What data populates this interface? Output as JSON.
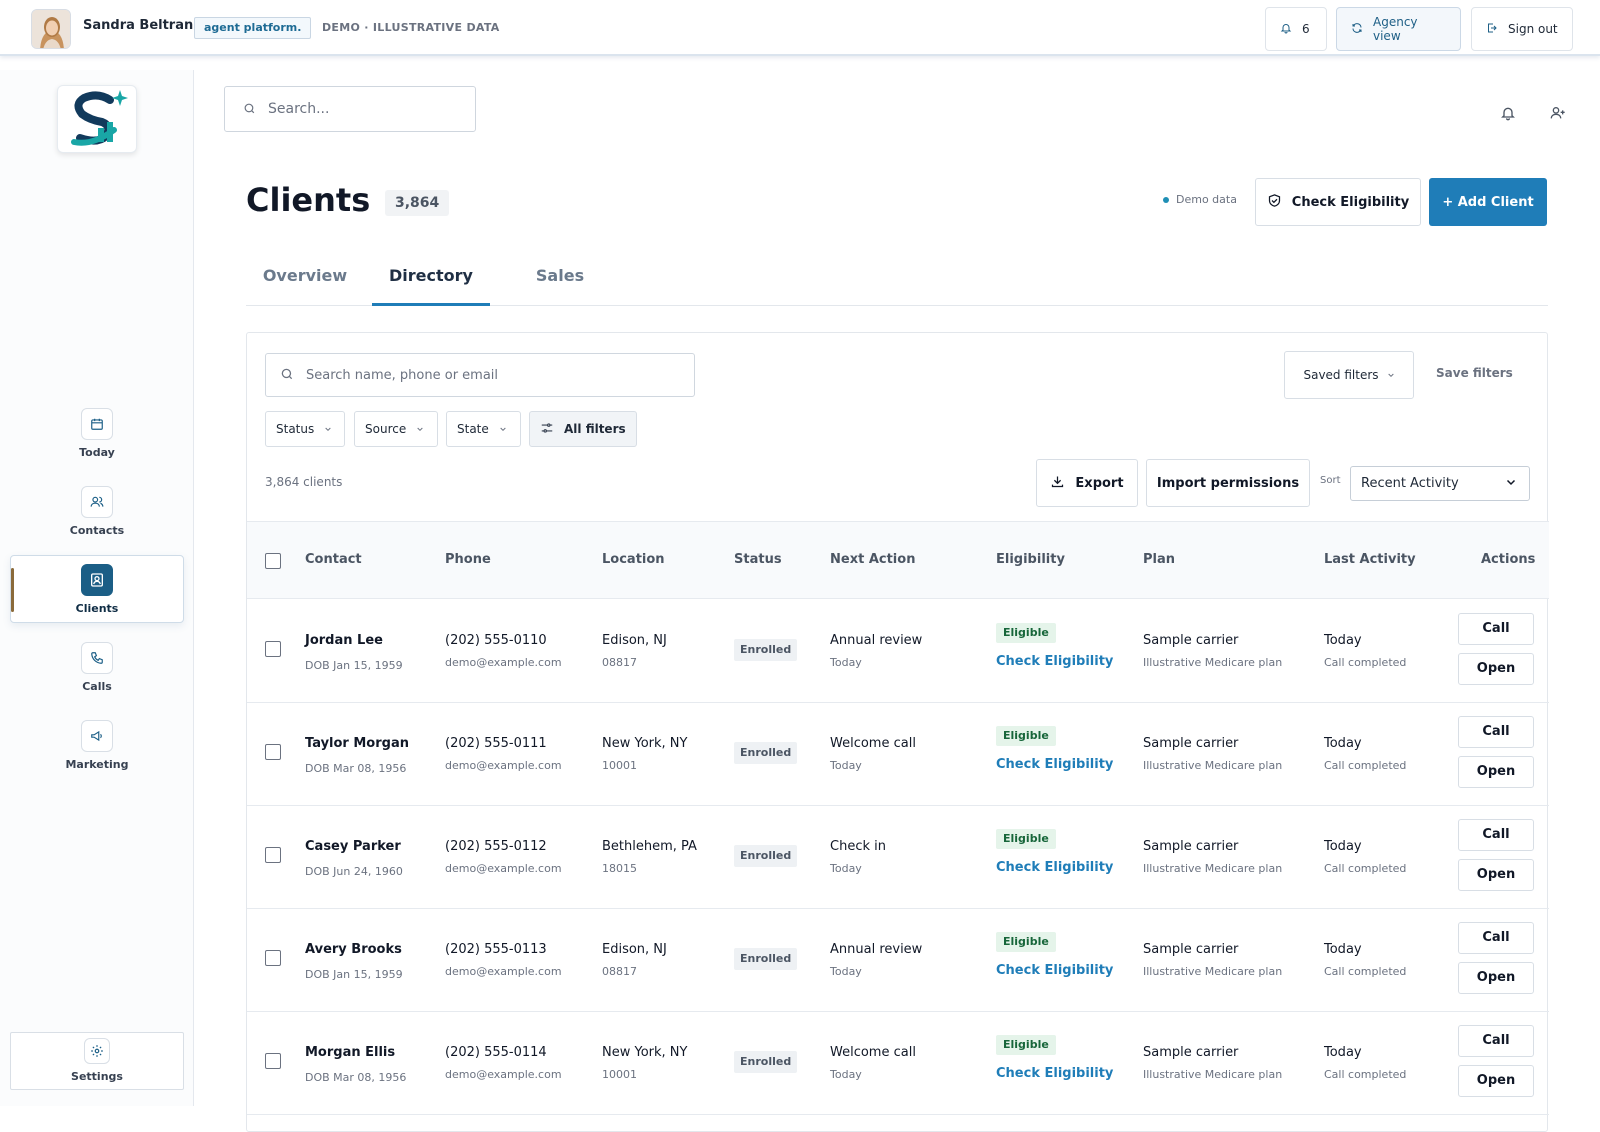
{
  "topbar": {
    "user_name": "Sandra Beltran",
    "brand_chip": "agent platform.",
    "demo_label": "DEMO · ILLUSTRATIVE DATA",
    "notifications_count": "6",
    "agency_view": "Agency view",
    "sign_out": "Sign out"
  },
  "sidebar": {
    "items": [
      {
        "label": "Today",
        "icon": "calendar-icon"
      },
      {
        "label": "Contacts",
        "icon": "users-icon"
      },
      {
        "label": "Clients",
        "icon": "client-card-icon"
      },
      {
        "label": "Calls",
        "icon": "phone-icon"
      },
      {
        "label": "Marketing",
        "icon": "megaphone-icon"
      }
    ],
    "settings": "Settings"
  },
  "header": {
    "search_placeholder": "Search...",
    "title": "Clients",
    "count": "3,864",
    "demo_data": "Demo data",
    "check_eligibility": "Check Eligibility",
    "add_client": "+ Add Client"
  },
  "tabs": [
    "Overview",
    "Directory",
    "Sales"
  ],
  "active_tab": "Directory",
  "directory": {
    "search_placeholder": "Search name, phone or email",
    "saved_filters": "Saved filters",
    "save_filters": "Save filters",
    "filters": [
      "Status",
      "Source",
      "State"
    ],
    "all_filters": "All filters",
    "client_count": "3,864 clients",
    "export": "Export",
    "import_permissions": "Import permissions",
    "sort_label": "Sort",
    "sort_value": "Recent Activity"
  },
  "table": {
    "columns": [
      "Contact",
      "Phone",
      "Location",
      "Status",
      "Next Action",
      "Eligibility",
      "Plan",
      "Last Activity",
      "Actions"
    ],
    "rows": [
      {
        "name": "Jordan Lee",
        "dob": "DOB Jan 15, 1959",
        "phone": "(202) 555-0110",
        "email": "demo@example.com",
        "city": "Edison, NJ",
        "zip": "08817",
        "status": "Enrolled",
        "next_action": "Annual review",
        "next_when": "Today",
        "eligibility": "Eligible",
        "check": "Check Eligibility",
        "plan": "Sample carrier",
        "plan_sub": "Illustrative Medicare plan",
        "last": "Today",
        "last_sub": "Call completed",
        "call": "Call",
        "open": "Open"
      },
      {
        "name": "Taylor Morgan",
        "dob": "DOB Mar 08, 1956",
        "phone": "(202) 555-0111",
        "email": "demo@example.com",
        "city": "New York, NY",
        "zip": "10001",
        "status": "Enrolled",
        "next_action": "Welcome call",
        "next_when": "Today",
        "eligibility": "Eligible",
        "check": "Check Eligibility",
        "plan": "Sample carrier",
        "plan_sub": "Illustrative Medicare plan",
        "last": "Today",
        "last_sub": "Call completed",
        "call": "Call",
        "open": "Open"
      },
      {
        "name": "Casey Parker",
        "dob": "DOB Jun 24, 1960",
        "phone": "(202) 555-0112",
        "email": "demo@example.com",
        "city": "Bethlehem, PA",
        "zip": "18015",
        "status": "Enrolled",
        "next_action": "Check in",
        "next_when": "Today",
        "eligibility": "Eligible",
        "check": "Check Eligibility",
        "plan": "Sample carrier",
        "plan_sub": "Illustrative Medicare plan",
        "last": "Today",
        "last_sub": "Call completed",
        "call": "Call",
        "open": "Open"
      },
      {
        "name": "Avery Brooks",
        "dob": "DOB Jan 15, 1959",
        "phone": "(202) 555-0113",
        "email": "demo@example.com",
        "city": "Edison, NJ",
        "zip": "08817",
        "status": "Enrolled",
        "next_action": "Annual review",
        "next_when": "Today",
        "eligibility": "Eligible",
        "check": "Check Eligibility",
        "plan": "Sample carrier",
        "plan_sub": "Illustrative Medicare plan",
        "last": "Today",
        "last_sub": "Call completed",
        "call": "Call",
        "open": "Open"
      },
      {
        "name": "Morgan Ellis",
        "dob": "DOB Mar 08, 1956",
        "phone": "(202) 555-0114",
        "email": "demo@example.com",
        "city": "New York, NY",
        "zip": "10001",
        "status": "Enrolled",
        "next_action": "Welcome call",
        "next_when": "Today",
        "eligibility": "Eligible",
        "check": "Check Eligibility",
        "plan": "Sample carrier",
        "plan_sub": "Illustrative Medicare plan",
        "last": "Today",
        "last_sub": "Call completed",
        "call": "Call",
        "open": "Open"
      }
    ]
  },
  "colors": {
    "accent": "#1f7db8",
    "nav_active": "#1b5e86",
    "eligible_bg": "#e5f4ea",
    "eligible_text": "#17663a"
  }
}
